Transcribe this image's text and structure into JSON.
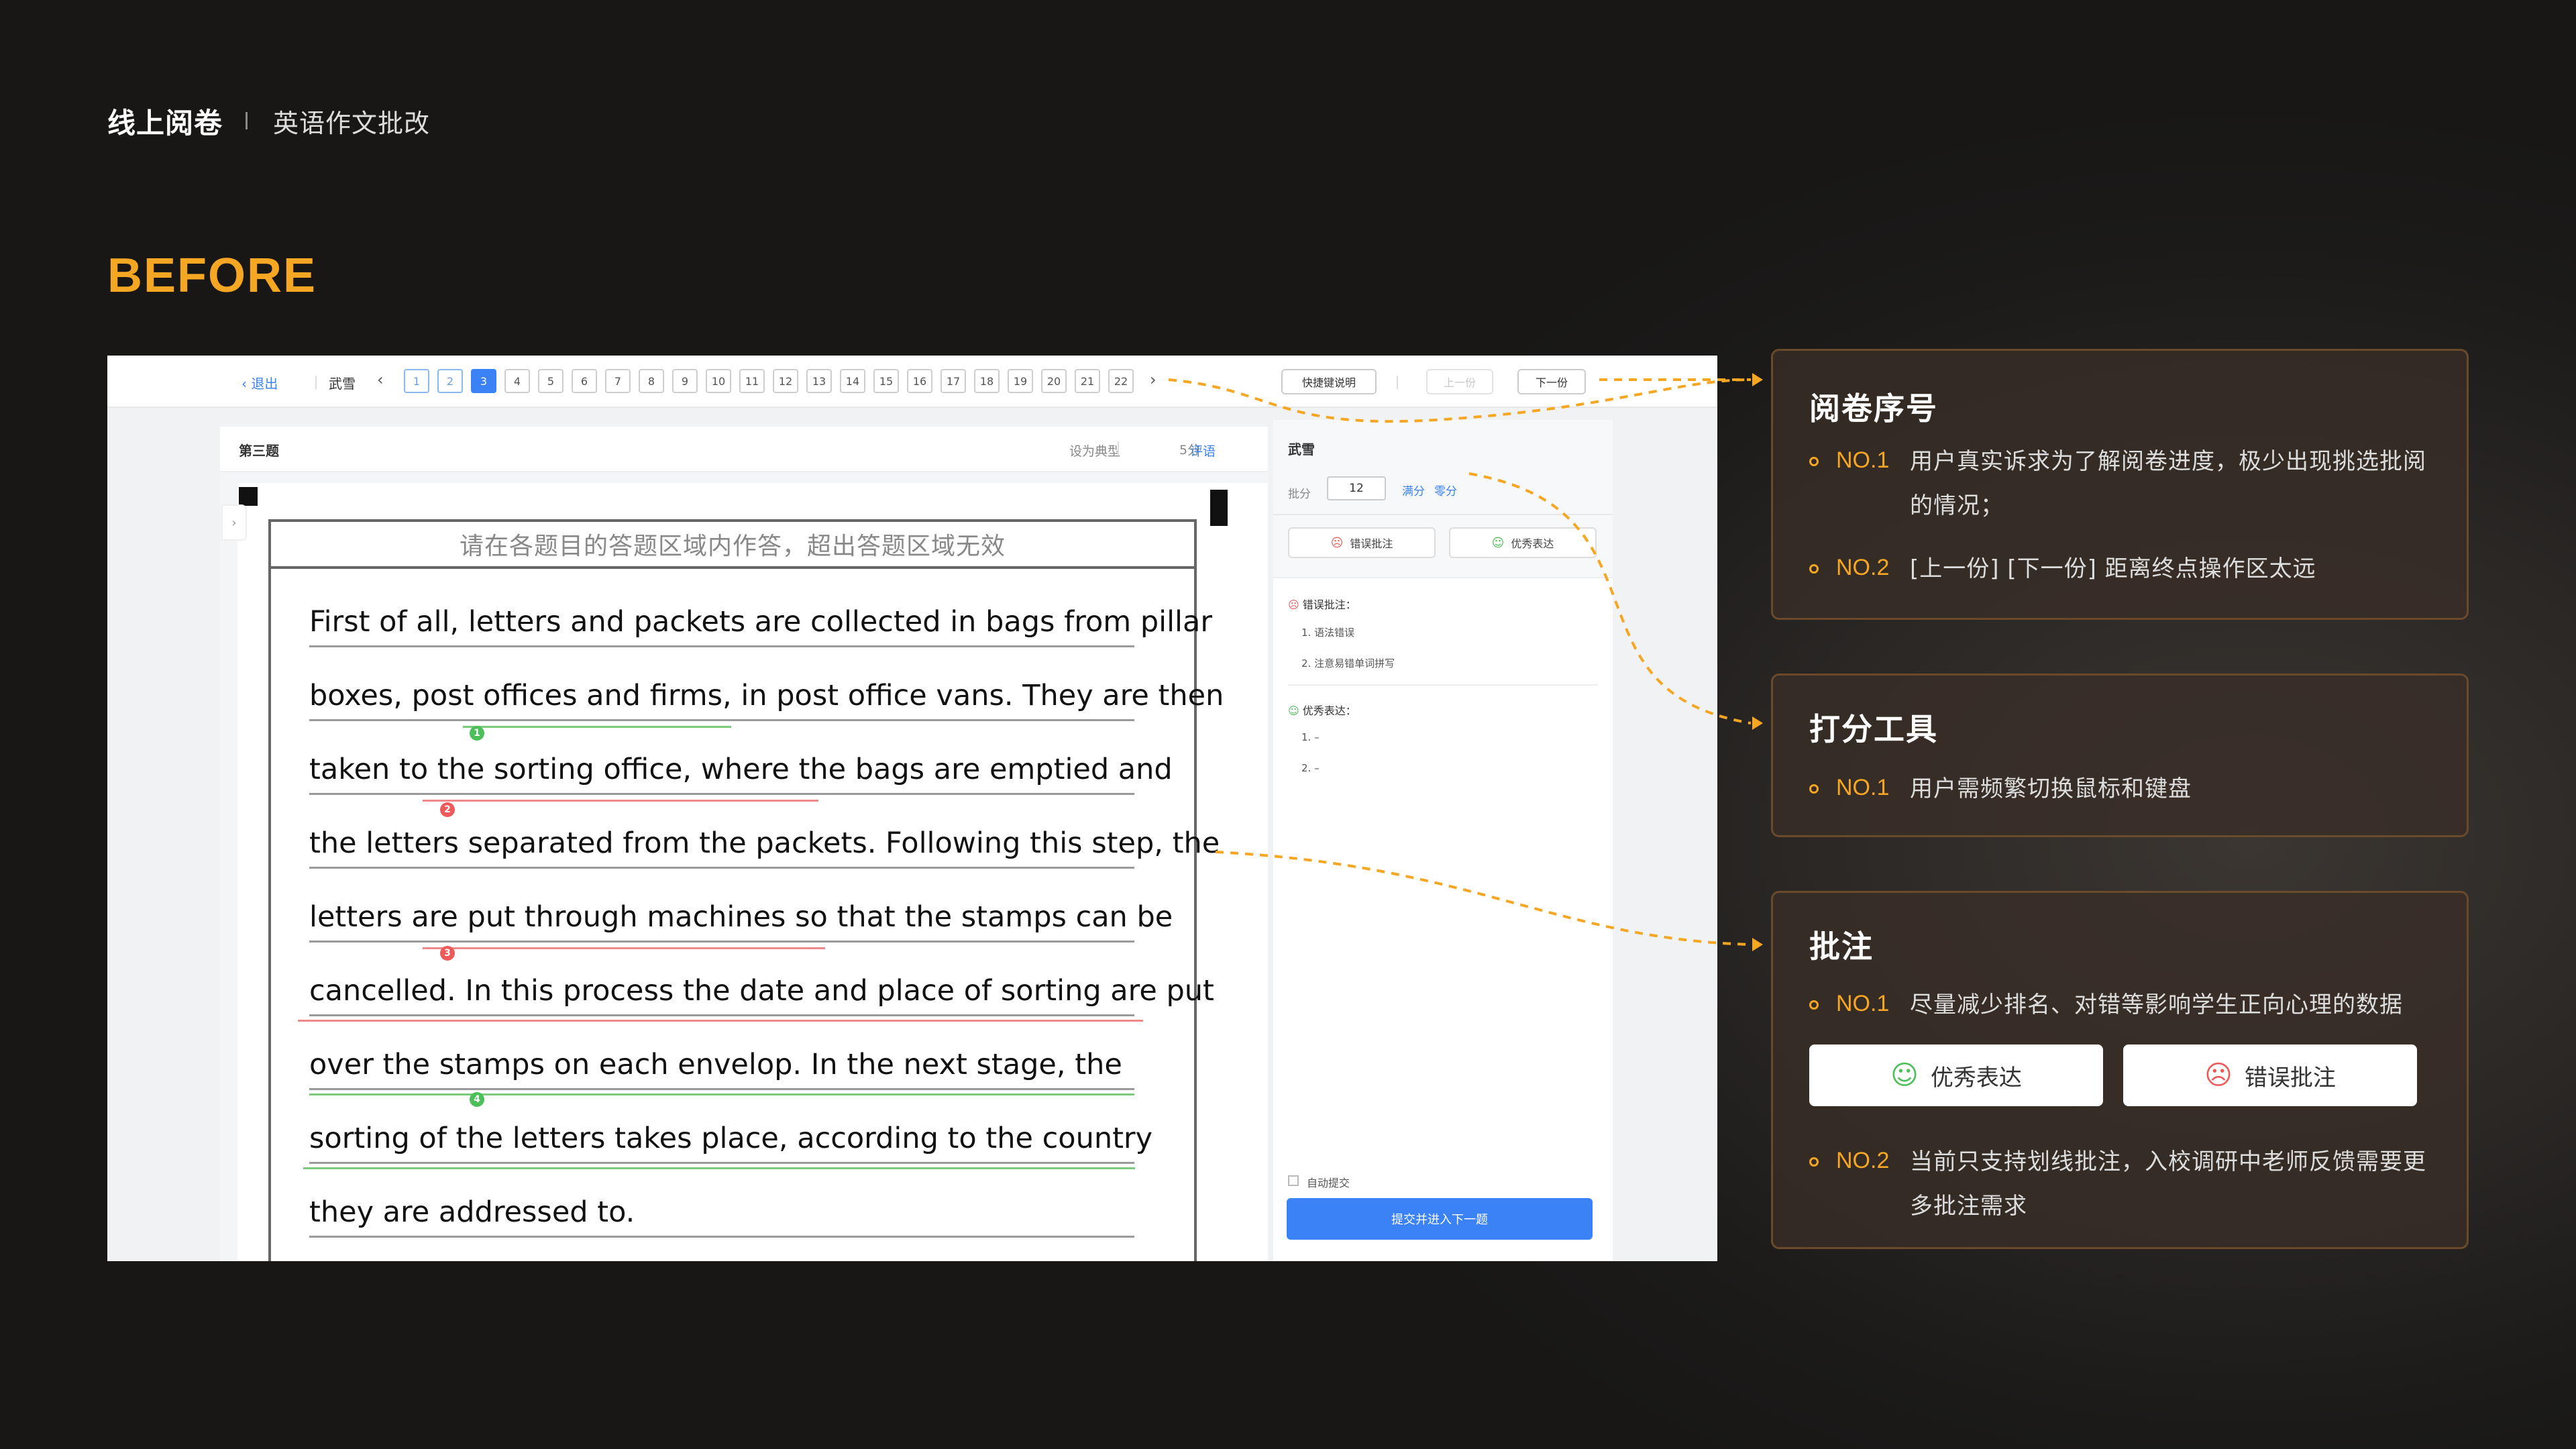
{
  "header": {
    "title": "线上阅卷",
    "subtitle": "英语作文批改"
  },
  "section_label": "BEFORE",
  "colors": {
    "accent": "#f5a623",
    "primary_blue": "#3b82f6",
    "error_red": "#ee5a5a",
    "good_green": "#4cbf5a"
  },
  "screenshot": {
    "topbar": {
      "back_label": "退出",
      "student_name": "武雪",
      "prev_icon": "chevron-left-icon",
      "next_icon": "chevron-right-icon",
      "pages": [
        "1",
        "2",
        "3",
        "4",
        "5",
        "6",
        "7",
        "8",
        "9",
        "10",
        "11",
        "12",
        "13",
        "14",
        "15",
        "16",
        "17",
        "18",
        "19",
        "20",
        "21",
        "22"
      ],
      "current_page": "3",
      "shortcut_label": "快捷键说明",
      "prev_copy_label": "上一份",
      "next_copy_label": "下一份"
    },
    "question": {
      "title": "第三题",
      "score": "5分",
      "set_typical": "设为典型",
      "evaluate": "评语",
      "hint": "请在各题目的答题区域内作答，超出答题区域无效",
      "lines": [
        "First of all, letters and packets are collected in bags from pillar",
        "boxes, post offices and firms, in post office vans. They are then",
        "taken to the sorting office, where the bags are emptied and",
        "the letters separated from the packets. Following this step, the",
        "letters are put through machines so that the stamps can be",
        "cancelled. In this process the date and place of sorting are put",
        "over the stamps on each envelop. In the next stage, the",
        "sorting of the letters takes place, according to the country",
        "they are addressed to."
      ],
      "markers": [
        "1",
        "2",
        "3",
        "4"
      ]
    },
    "right_panel": {
      "student_name": "武雪",
      "score_label": "批分",
      "score_value": "12",
      "full_label": "满分",
      "zero_label": "零分",
      "error_btn": "错误批注",
      "good_btn": "优秀表达",
      "error_section": "错误批注：",
      "error_items": [
        "1.  语法错误",
        "2.  注意易错单词拼写"
      ],
      "good_section": "优秀表达：",
      "good_items": [
        "1.  –",
        "2.  –"
      ],
      "auto_submit": "自动提交",
      "submit_btn": "提交并进入下一题"
    }
  },
  "cards": [
    {
      "title": "阅卷序号",
      "items": [
        {
          "no": "NO.1",
          "text": "用户真实诉求为了解阅卷进度，极少出现挑选批阅的情况；"
        },
        {
          "no": "NO.2",
          "text": "[上一份] [下一份] 距离终点操作区太远"
        }
      ]
    },
    {
      "title": "打分工具",
      "items": [
        {
          "no": "NO.1",
          "text": "用户需频繁切换鼠标和键盘"
        }
      ]
    },
    {
      "title": "批注",
      "items": [
        {
          "no": "NO.1",
          "text": "尽量减少排名、对错等影响学生正向心理的数据"
        },
        {
          "no": "NO.2",
          "text": "当前只支持划线批注，入校调研中老师反馈需要更多批注需求"
        }
      ],
      "buttons": [
        {
          "label": "优秀表达",
          "icon": "smile-icon"
        },
        {
          "label": "错误批注",
          "icon": "frown-icon"
        }
      ]
    }
  ]
}
